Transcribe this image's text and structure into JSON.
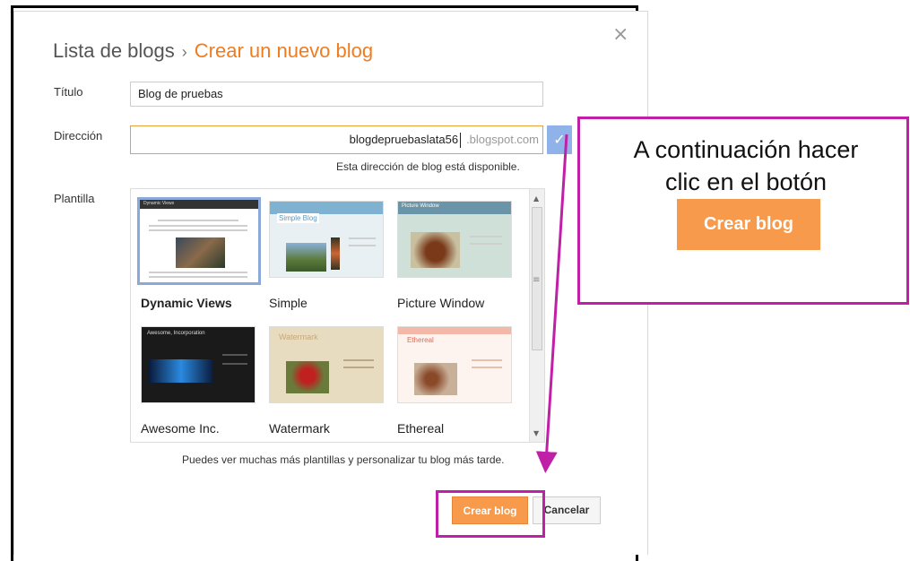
{
  "dialog": {
    "breadcrumb_parent": "Lista de blogs",
    "breadcrumb_sep": "›",
    "breadcrumb_current": "Crear un nuevo blog",
    "close_glyph": "×"
  },
  "form": {
    "title_label": "Título",
    "title_value": "Blog de pruebas",
    "address_label": "Dirección",
    "address_value": "blogdepruebaslata56",
    "address_suffix": ".blogspot.com",
    "check_glyph": "✓",
    "available_text": "Esta dirección de blog está disponible.",
    "template_label": "Plantilla"
  },
  "templates": [
    {
      "name": "Dynamic Views",
      "selected": true
    },
    {
      "name": "Simple",
      "selected": false
    },
    {
      "name": "Picture Window",
      "selected": false
    },
    {
      "name": "Awesome Inc.",
      "selected": false
    },
    {
      "name": "Watermark",
      "selected": false
    },
    {
      "name": "Ethereal",
      "selected": false
    }
  ],
  "thumb_text": {
    "dynamic": "Dynamic Views",
    "simple": "Simple Blog",
    "picture": "Picture Window",
    "awesome": "Awesome, Incorporation",
    "watermark": "Watermark",
    "ethereal": "Ethereal"
  },
  "footer": {
    "more_text": "Puedes ver muchas más plantillas y personalizar tu blog más tarde.",
    "create_label": "Crear blog",
    "cancel_label": "Cancelar"
  },
  "callout": {
    "line1": "A continuación hacer",
    "line2": "clic en el botón",
    "button_label": "Crear blog"
  },
  "colors": {
    "accent_orange": "#f07c20",
    "button_orange": "#f79a4c",
    "highlight_magenta": "#c020a8",
    "check_blue": "#8fb3e8"
  }
}
